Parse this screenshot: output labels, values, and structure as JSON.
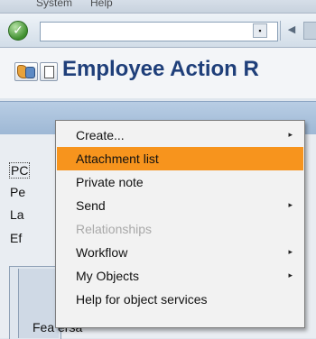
{
  "menubar": {
    "items": [
      "System",
      "Help"
    ]
  },
  "toolbar": {
    "ok_icon": "check-circle-icon",
    "command_value": "",
    "dropdown_glyph": "▪",
    "back_glyph": "◀"
  },
  "title_bar": {
    "title": "Employee Action R"
  },
  "form_labels": [
    "PC",
    "Pe",
    "La",
    "Ef"
  ],
  "bottom_label": "Fea ersa",
  "context_menu": {
    "items": [
      {
        "label": "Create...",
        "submenu": true,
        "state": "normal"
      },
      {
        "label": "Attachment list",
        "submenu": false,
        "state": "highlighted"
      },
      {
        "label": "Private note",
        "submenu": false,
        "state": "normal"
      },
      {
        "label": "Send",
        "submenu": true,
        "state": "normal"
      },
      {
        "label": "Relationships",
        "submenu": false,
        "state": "disabled"
      },
      {
        "label": "Workflow",
        "submenu": true,
        "state": "normal"
      },
      {
        "label": "My Objects",
        "submenu": true,
        "state": "normal"
      },
      {
        "label": "Help for object services",
        "submenu": false,
        "state": "normal"
      }
    ],
    "submenu_arrow": "▸"
  },
  "colors": {
    "highlight": "#f7941d",
    "title": "#1f3f7a",
    "band": "#b8cde4"
  }
}
